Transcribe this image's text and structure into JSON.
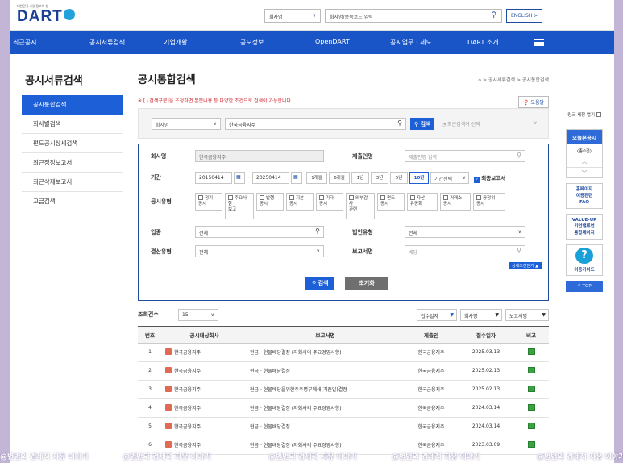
{
  "header": {
    "logo_small": "대한민국 기업정보의 창",
    "logo_text": "DART",
    "search_select": "회사명",
    "search_placeholder": "회사명/종목코드 입력",
    "english_label": "ENGLISH >"
  },
  "nav": [
    "최근공시",
    "공시서류검색",
    "기업개황",
    "공모정보",
    "OpenDART",
    "공시업무 · 제도",
    "DART 소개"
  ],
  "sidebar": {
    "title": "공시서류검색",
    "items": [
      {
        "label": "공시통합검색",
        "active": true
      },
      {
        "label": "회사별검색"
      },
      {
        "label": "펀드공시상세검색"
      },
      {
        "label": "최근정정보고서"
      },
      {
        "label": "최근삭제보고서"
      },
      {
        "label": "고급검색"
      }
    ]
  },
  "main": {
    "title": "공시통합검색",
    "breadcrumb": "⌂ > 공시서류검색 > 공시통합검색",
    "notice": "※ [↓검색구분]을 조정하면 본문내용 등 다양한 조건으로 검색이 가능합니다.",
    "help": "❓ 도움말",
    "quick": {
      "select": "회사명",
      "value": "한국금융지주",
      "search_btn": "검색",
      "recent_label": "최근검색어 선택"
    },
    "form": {
      "company_label": "회사명",
      "company_value": "한국금융지주",
      "filer_label": "제출인명",
      "filer_placeholder": "제출인명 입력",
      "period_label": "기간",
      "date_from": "20150414",
      "date_to": "20250414",
      "periods": [
        "1개월",
        "6개월",
        "1년",
        "3년",
        "5년",
        "10년"
      ],
      "period_select": "기간선택",
      "final_report": "최종보고서",
      "type_label": "공시유형",
      "types": [
        "정기\n공시",
        "주요사항\n보고",
        "발행\n공시",
        "지분\n공시",
        "기타\n공시",
        "외부감사\n관련",
        "펀드\n공시",
        "자산\n유동화",
        "거래소\n공시",
        "공정위\n공시"
      ],
      "industry_label": "업종",
      "industry_value": "전체",
      "corp_type_label": "법인유형",
      "corp_type_value": "전체",
      "settle_label": "결산유형",
      "settle_value": "전체",
      "report_label": "보고서명",
      "report_placeholder": "배당",
      "toggle": "상세조건닫기 ▲",
      "search_btn": "검색",
      "reset_btn": "초기화"
    },
    "results": {
      "count_label": "조회건수",
      "count_value": "15",
      "sorts": [
        "접수일자",
        "회사명",
        "보고서명"
      ],
      "headers": [
        "번호",
        "공시대상회사",
        "보고서명",
        "제출인",
        "접수일자",
        "비고"
      ],
      "rows": [
        {
          "no": "1",
          "company": "한국금융지주",
          "report": "현금 · 현물배당결정 (자회사의 주요경영사항)",
          "filer": "한국금융지주",
          "date": "2025.03.13"
        },
        {
          "no": "2",
          "company": "한국금융지주",
          "report": "현금 · 현물배당결정",
          "filer": "한국금융지주",
          "date": "2025.02.13"
        },
        {
          "no": "3",
          "company": "한국금융지주",
          "report": "현금 · 현물배당을위한주주명부폐쇄(기준일)결정",
          "filer": "한국금융지주",
          "date": "2025.02.13"
        },
        {
          "no": "4",
          "company": "한국금융지주",
          "report": "현금 · 현물배당결정 (자회사의 주요경영사항)",
          "filer": "한국금융지주",
          "date": "2024.03.14"
        },
        {
          "no": "5",
          "company": "한국금융지주",
          "report": "현금 · 현물배당결정",
          "filer": "한국금융지주",
          "date": "2024.03.14"
        },
        {
          "no": "6",
          "company": "한국금융지주",
          "report": "현금 · 현물배당결정 (자회사의 주요경영사항)",
          "filer": "한국금융지주",
          "date": "2023.03.09"
        }
      ]
    }
  },
  "quick_menu": {
    "top_text": "링크 새창 열기",
    "today": "오늘본공시",
    "today_count": "(총0건)",
    "homepage": "홈페이지\n이용관련\nFAQ",
    "valueup": "VALUE-UP\n기업밸류업\n통합페이지",
    "guide": "이용가이드",
    "top": "^ TOP"
  },
  "watermark": "@별별의 경제적 자유 이야기"
}
